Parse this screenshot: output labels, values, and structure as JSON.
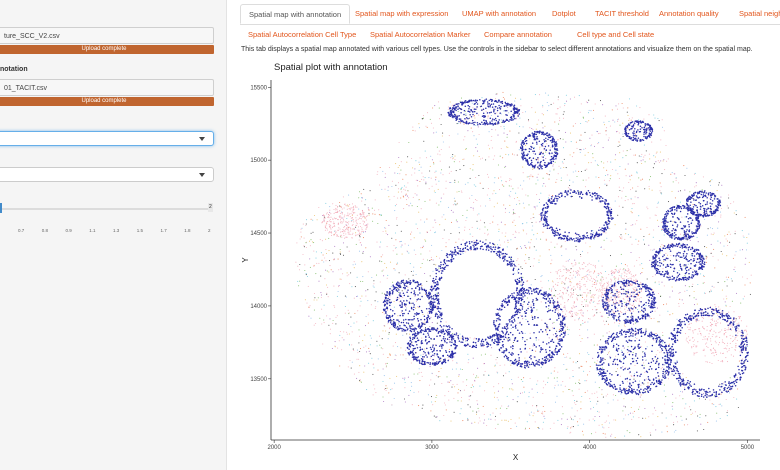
{
  "sidebar": {
    "file1_name": "ture_SCC_V2.csv",
    "file1_status": "Upload complete",
    "annotation_label": "notation",
    "file2_name": "01_TACIT.csv",
    "file2_status": "Upload complete",
    "select1_value": "",
    "select2_value": "",
    "slider_max": "2",
    "slider_ticks": [
      "0.7",
      "0.8",
      "0.9",
      "1.1",
      "1.3",
      "1.5",
      "1.7",
      "1.8",
      "2"
    ]
  },
  "tabs": [
    {
      "label": "Spatial map with annotation",
      "active": true
    },
    {
      "label": "Spatial map with expression",
      "active": false
    },
    {
      "label": "UMAP with annotation",
      "active": false
    },
    {
      "label": "Dotplot",
      "active": false
    },
    {
      "label": "TACIT threshold",
      "active": false
    },
    {
      "label": "Annotation quality",
      "active": false
    },
    {
      "label": "Spatial neigh",
      "active": false
    },
    {
      "label": "Spatial Autocorrelation Cell Type",
      "active": false
    },
    {
      "label": "Spatial Autocorrelation Marker",
      "active": false
    },
    {
      "label": "Compare annotation",
      "active": false
    },
    {
      "label": "Cell type and Cell state",
      "active": false
    }
  ],
  "main": {
    "description": "This tab displays a spatial map annotated with various cell types. Use the controls in the sidebar to select different annotations and visualize them on the spatial map."
  },
  "chart_data": {
    "type": "scatter",
    "title": "Spatial plot with annotation",
    "xlabel": "X",
    "ylabel": "Y",
    "x_ticks": [
      2000,
      3000,
      4000,
      5000
    ],
    "y_ticks": [
      13500,
      14000,
      14500,
      15000,
      15500
    ],
    "xlim": [
      1980,
      5080
    ],
    "ylim": [
      13080,
      15550
    ],
    "grid": false,
    "legend": "none",
    "colors": {
      "dominant_cluster": "#2b2fa8",
      "secondary_cluster": "#f0a0b0",
      "other_types": [
        "#e6b44c",
        "#5cc0d8",
        "#6ab04c",
        "#e86a3a",
        "#9b59b6",
        "#7fb3e8",
        "#222222"
      ]
    },
    "regions_note": "dense blue cell clusters in blob-shaped regions over a mixed multi-color background",
    "blue_clusters": [
      {
        "cx": 3290,
        "cy": 14080,
        "rx": 300,
        "ry": 370
      },
      {
        "cx": 3620,
        "cy": 13850,
        "rx": 230,
        "ry": 280
      },
      {
        "cx": 4750,
        "cy": 13680,
        "rx": 260,
        "ry": 310
      },
      {
        "cx": 4280,
        "cy": 13620,
        "rx": 240,
        "ry": 230
      },
      {
        "cx": 3920,
        "cy": 14620,
        "rx": 230,
        "ry": 180
      },
      {
        "cx": 3330,
        "cy": 15330,
        "rx": 230,
        "ry": 90
      },
      {
        "cx": 3680,
        "cy": 15070,
        "rx": 120,
        "ry": 130
      },
      {
        "cx": 4560,
        "cy": 14300,
        "rx": 170,
        "ry": 130
      },
      {
        "cx": 4580,
        "cy": 14570,
        "rx": 120,
        "ry": 120
      },
      {
        "cx": 2850,
        "cy": 14000,
        "rx": 160,
        "ry": 180
      },
      {
        "cx": 4310,
        "cy": 15200,
        "rx": 90,
        "ry": 70
      },
      {
        "cx": 3000,
        "cy": 13720,
        "rx": 160,
        "ry": 130
      },
      {
        "cx": 4250,
        "cy": 14030,
        "rx": 170,
        "ry": 150
      },
      {
        "cx": 4720,
        "cy": 14700,
        "rx": 110,
        "ry": 90
      }
    ],
    "pink_regions": [
      {
        "cx": 3930,
        "cy": 14100,
        "rx": 180,
        "ry": 220
      },
      {
        "cx": 4200,
        "cy": 14100,
        "rx": 140,
        "ry": 160
      },
      {
        "cx": 4800,
        "cy": 13800,
        "rx": 200,
        "ry": 200
      },
      {
        "cx": 2450,
        "cy": 14580,
        "rx": 150,
        "ry": 120
      }
    ]
  }
}
